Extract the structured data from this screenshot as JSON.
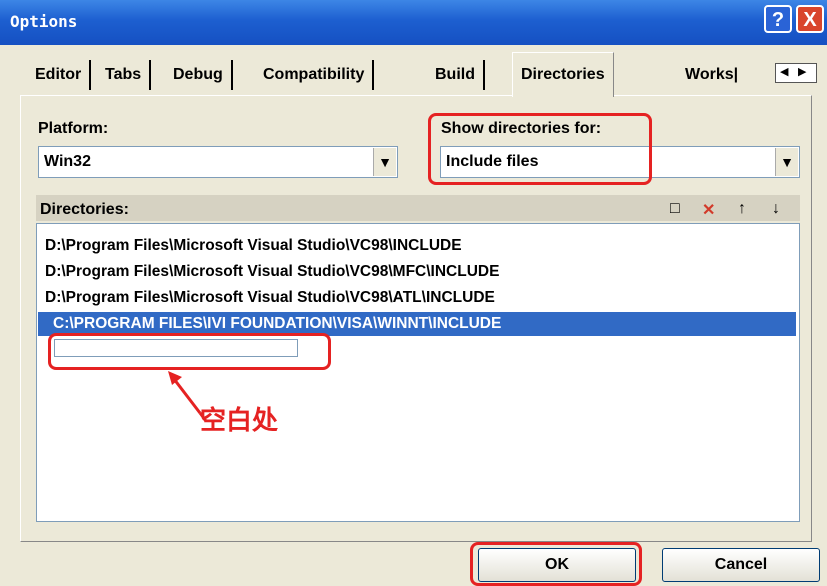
{
  "window": {
    "title": "Options",
    "help_label": "?",
    "close_label": "X"
  },
  "tabs": [
    "Editor",
    "Tabs",
    "Debug",
    "Compatibility",
    "Build",
    "Directories",
    "Works|"
  ],
  "active_tab": "Directories",
  "platform": {
    "label": "Platform:",
    "value": "Win32"
  },
  "show_dirs": {
    "label": "Show directories for:",
    "value": "Include files"
  },
  "directories": {
    "label": "Directories:",
    "items": [
      "D:\\Program Files\\Microsoft Visual Studio\\VC98\\INCLUDE",
      "D:\\Program Files\\Microsoft Visual Studio\\VC98\\MFC\\INCLUDE",
      "D:\\Program Files\\Microsoft Visual Studio\\VC98\\ATL\\INCLUDE",
      "C:\\PROGRAM FILES\\IVI FOUNDATION\\VISA\\WINNT\\INCLUDE"
    ],
    "selected_index": 3
  },
  "annotation": "空白处",
  "buttons": {
    "ok": "OK",
    "cancel": "Cancel"
  },
  "colors": {
    "title_bar": "#1d5fd0",
    "selection": "#316ac5",
    "highlight": "#e52222",
    "dialog_bg": "#ece9d8"
  }
}
